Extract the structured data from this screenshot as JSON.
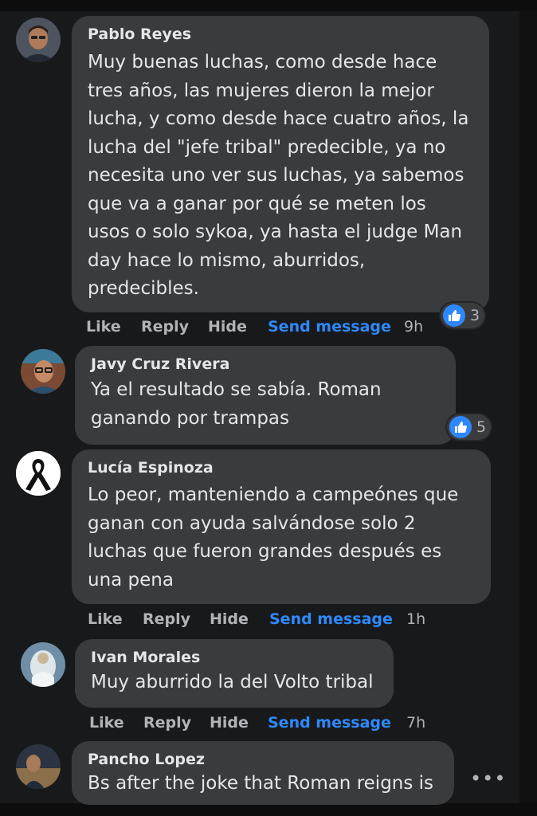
{
  "actions": {
    "like": "Like",
    "reply": "Reply",
    "hide": "Hide",
    "send": "Send message"
  },
  "comments": [
    {
      "author": "Pablo Reyes",
      "lines": [
        "Muy buenas luchas, como desde hace",
        "tres años, las mujeres dieron la mejor",
        "lucha, y como desde hace cuatro años, la",
        "lucha del \"jefe tribal\" predecible, ya no",
        "necesita uno ver sus luchas, ya sabemos",
        "que va a ganar por qué se meten los",
        "usos o solo sykoa, ya hasta el judge Man",
        "day hace lo mismo, aburridos,",
        "predecibles."
      ],
      "time": "9h",
      "reactions": "3"
    },
    {
      "author": "Javy Cruz Rivera",
      "lines": [
        "Ya el resultado se sabía. Roman",
        "ganando por trampas"
      ],
      "reactions": "5"
    },
    {
      "author": "Lucía Espinoza",
      "lines": [
        "Lo peor, manteniendo a campeónes que",
        "ganan con ayuda salvándose solo 2",
        "luchas que fueron grandes después es",
        "una pena"
      ],
      "time": "1h"
    },
    {
      "author": "Ivan Morales",
      "lines": [
        "Muy aburrido la del Volto tribal"
      ],
      "time": "7h"
    },
    {
      "author": "Pancho Lopez",
      "lines": [
        "Bs after the joke that Roman reigns is"
      ],
      "more": "•••"
    }
  ],
  "colors": {
    "background": "#18191a",
    "bubble": "#3a3b3c",
    "link": "#2e89ff",
    "like_badge": "#2d88ff"
  },
  "icons": [
    "like-thumb-icon",
    "more-options-icon",
    "mourning-ribbon-icon"
  ]
}
